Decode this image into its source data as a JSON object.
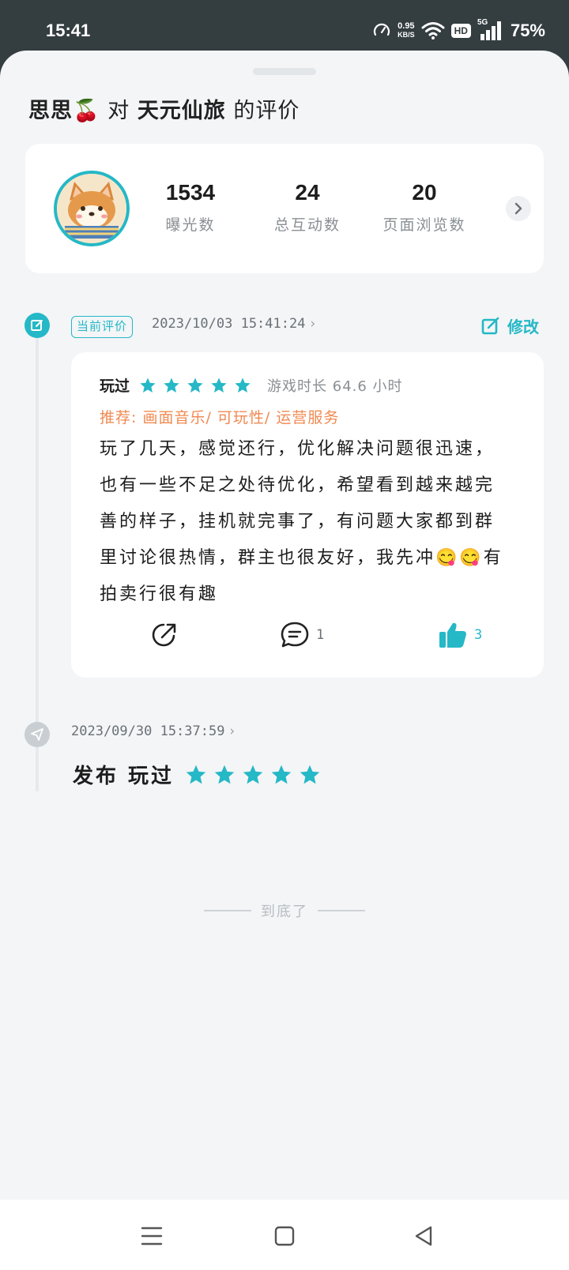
{
  "status_bar": {
    "time": "15:41",
    "net_speed_value": "0.95",
    "net_speed_unit": "KB/S",
    "hd_badge": "HD",
    "network_type": "5G",
    "battery": "75%"
  },
  "header": {
    "user_name": "思思🍒",
    "connector": "对",
    "game_name": "天元仙旅",
    "suffix": "的评价"
  },
  "stats": [
    {
      "value": "1534",
      "label": "曝光数"
    },
    {
      "value": "24",
      "label": "总互动数"
    },
    {
      "value": "20",
      "label": "页面浏览数"
    }
  ],
  "current_review": {
    "badge": "当前评价",
    "datetime": "2023/10/03 15:41:24",
    "edit_label": "修改",
    "played_label": "玩过",
    "rating": 5,
    "playtime": "游戏时长 64.6 小时",
    "recommend": "推荐: 画面音乐/ 可玩性/ 运营服务",
    "text": "玩了几天，感觉还行，优化解决问题很迅速，也有一些不足之处待优化，希望看到越来越完善的样子，挂机就完事了，有问题大家都到群里讨论很热情，群主也很友好，我先冲😋😋有拍卖行很有趣",
    "comment_count": "1",
    "like_count": "3"
  },
  "publish_event": {
    "datetime": "2023/09/30 15:37:59",
    "label": "发布 玩过",
    "rating": 5
  },
  "end_text": "到底了",
  "colors": {
    "accent": "#25b8c6",
    "recommend": "#f08a52",
    "status_bar_bg": "#343d40",
    "sheet_bg": "#f3f5f7"
  }
}
